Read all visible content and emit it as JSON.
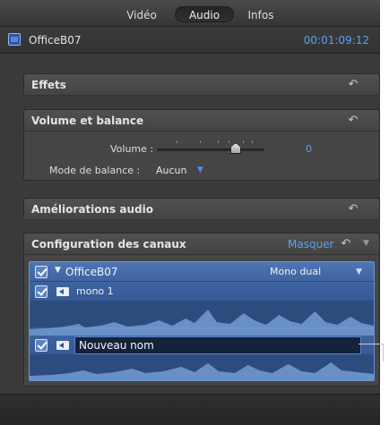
{
  "tabs": [
    {
      "label": "Vidéo",
      "selected": false
    },
    {
      "label": "Audio",
      "selected": true
    },
    {
      "label": "Infos",
      "selected": false
    }
  ],
  "clip": {
    "name": "OfficeB07",
    "timecode": "00:01:09:12"
  },
  "sections": {
    "effets": {
      "title": "Effets"
    },
    "volume": {
      "title": "Volume et balance",
      "volume_label": "Volume :",
      "volume_value": "0",
      "balance_label": "Mode de balance :",
      "balance_value": "Aucun"
    },
    "ameliorations": {
      "title": "Améliorations audio"
    },
    "canaux": {
      "title": "Configuration des canaux",
      "hide_label": "Masquer",
      "group": {
        "name": "OfficeB07",
        "mode": "Mono dual",
        "checked": true
      },
      "channels": [
        {
          "name": "mono 1",
          "checked": true
        },
        {
          "name": "Nouveau nom",
          "checked": true,
          "editing": true
        }
      ]
    }
  },
  "colors": {
    "panel": "#3a3a3a",
    "accent": "#5fa0ec",
    "selection": "#4f76b4",
    "waveform": "#7ea6e0"
  },
  "icons": {
    "reset": "reset-arrow-icon",
    "clip": "clip-icon",
    "speaker": "speaker-icon",
    "disclosure": "disclosure-triangle-icon",
    "chevron": "chevron-down-icon"
  }
}
